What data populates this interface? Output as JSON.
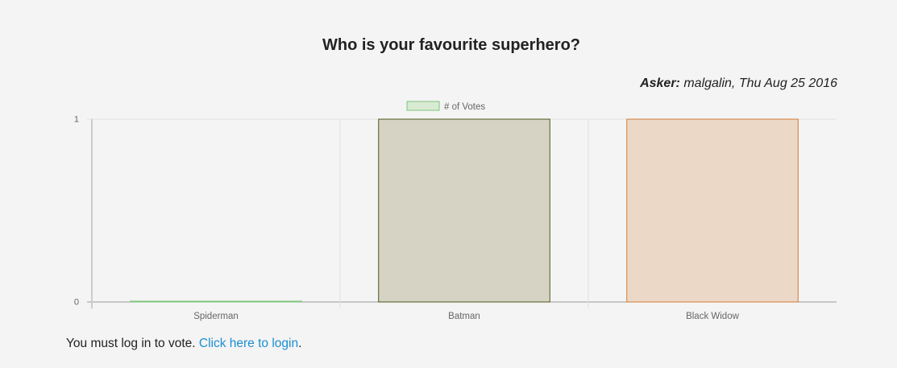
{
  "poll": {
    "title": "Who is your favourite superhero?",
    "asker_label": "Asker:",
    "asker_details": "malgalin, Thu Aug 25 2016"
  },
  "footer": {
    "text": "You must log in to vote. ",
    "login_link": "Click here to login",
    "suffix": "."
  },
  "colors": {
    "series": [
      "#7cc47c",
      "#4a5a1e",
      "#d37a35"
    ],
    "fills": [
      "#d9ead3",
      "#d6d3c4",
      "#ecd8c6"
    ],
    "grid": "#e1e1e1",
    "axis": "#cccccc",
    "tick_text": "#666666"
  },
  "chart_data": {
    "type": "bar",
    "categories": [
      "Spiderman",
      "Batman",
      "Black Widow"
    ],
    "series": [
      {
        "name": "# of Votes",
        "values": [
          0,
          1,
          1
        ]
      }
    ],
    "y_ticks": [
      "0",
      "1"
    ],
    "ylim": [
      0,
      1
    ],
    "legend_position": "top",
    "grid": true
  }
}
